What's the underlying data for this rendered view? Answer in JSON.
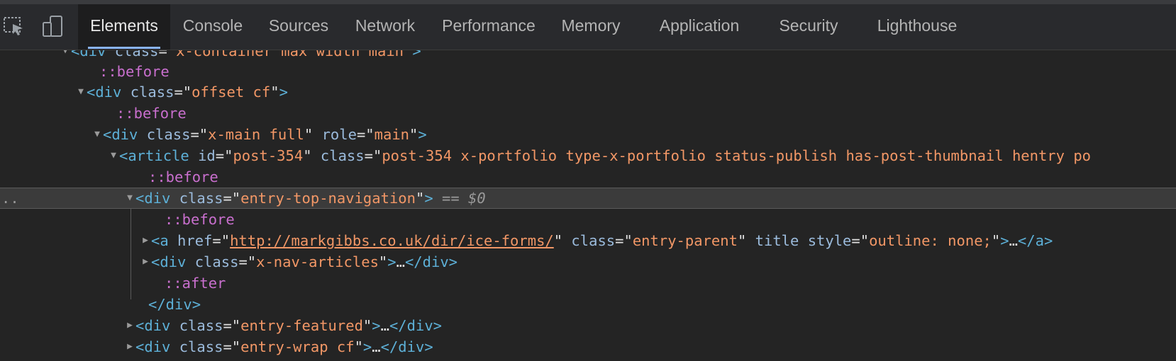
{
  "toolbar": {
    "icons": [
      "inspect-element-icon",
      "device-toolbar-icon"
    ],
    "tabs": [
      {
        "label": "Elements",
        "active": true
      },
      {
        "label": "Console"
      },
      {
        "label": "Sources"
      },
      {
        "label": "Network"
      },
      {
        "label": "Performance"
      },
      {
        "label": "Memory"
      },
      {
        "label": "Application"
      },
      {
        "label": "Security"
      },
      {
        "label": "Lighthouse"
      }
    ]
  },
  "colors": {
    "background": "#242424",
    "tag": "#5db0d7",
    "attribute_name": "#9bbbdc",
    "attribute_value": "#f29766",
    "pseudo_element": "#c96fce",
    "active_tab_underline": "#8ab4f8"
  },
  "dom_tree": {
    "rows": [
      {
        "parts": [
          {
            "t": "<div",
            "c": "tag"
          },
          {
            "t": " class",
            "c": "attr"
          },
          {
            "t": "=\"",
            "c": "text"
          },
          {
            "t": "x-container max width main",
            "c": "val"
          },
          {
            "t": "\">",
            "c": "tag"
          }
        ]
      },
      {
        "parts": [
          {
            "t": "::before",
            "c": "pseudo"
          }
        ]
      },
      {
        "parts": [
          {
            "t": "<div",
            "c": "tag"
          },
          {
            "t": " class",
            "c": "attr"
          },
          {
            "t": "=\"",
            "c": "text"
          },
          {
            "t": "offset cf",
            "c": "val"
          },
          {
            "t": "\"",
            "c": "text"
          },
          {
            "t": ">",
            "c": "tag"
          }
        ]
      },
      {
        "parts": [
          {
            "t": "::before",
            "c": "pseudo"
          }
        ]
      },
      {
        "parts": [
          {
            "t": "<div",
            "c": "tag"
          },
          {
            "t": " class",
            "c": "attr"
          },
          {
            "t": "=\"",
            "c": "text"
          },
          {
            "t": "x-main full",
            "c": "val"
          },
          {
            "t": "\"",
            "c": "text"
          },
          {
            "t": " role",
            "c": "attr"
          },
          {
            "t": "=\"",
            "c": "text"
          },
          {
            "t": "main",
            "c": "val"
          },
          {
            "t": "\"",
            "c": "text"
          },
          {
            "t": ">",
            "c": "tag"
          }
        ]
      },
      {
        "parts": [
          {
            "t": "<article",
            "c": "tag"
          },
          {
            "t": " id",
            "c": "attr"
          },
          {
            "t": "=\"",
            "c": "text"
          },
          {
            "t": "post-354",
            "c": "val"
          },
          {
            "t": "\"",
            "c": "text"
          },
          {
            "t": " class",
            "c": "attr"
          },
          {
            "t": "=\"",
            "c": "text"
          },
          {
            "t": "post-354 x-portfolio type-x-portfolio status-publish has-post-thumbnail hentry po",
            "c": "val"
          }
        ]
      },
      {
        "parts": [
          {
            "t": "::before",
            "c": "pseudo"
          }
        ]
      },
      {
        "parts": [
          {
            "t": "<div",
            "c": "tag"
          },
          {
            "t": " class",
            "c": "attr"
          },
          {
            "t": "=\"",
            "c": "text"
          },
          {
            "t": "entry-top-navigation",
            "c": "val"
          },
          {
            "t": "\"",
            "c": "text"
          },
          {
            "t": ">",
            "c": "tag"
          },
          {
            "t": " == ",
            "c": "dim"
          },
          {
            "t": "$0",
            "c": "ref"
          }
        ]
      },
      {
        "parts": [
          {
            "t": "::before",
            "c": "pseudo"
          }
        ]
      },
      {
        "parts": [
          {
            "t": "<a",
            "c": "tag"
          },
          {
            "t": " href",
            "c": "attr"
          },
          {
            "t": "=\"",
            "c": "text"
          },
          {
            "t": "http://markgibbs.co.uk/dir/ice-forms/",
            "c": "link"
          },
          {
            "t": "\"",
            "c": "text"
          },
          {
            "t": " class",
            "c": "attr"
          },
          {
            "t": "=\"",
            "c": "text"
          },
          {
            "t": "entry-parent",
            "c": "val"
          },
          {
            "t": "\"",
            "c": "text"
          },
          {
            "t": " title style",
            "c": "attr"
          },
          {
            "t": "=\"",
            "c": "text"
          },
          {
            "t": "outline: none;",
            "c": "val"
          },
          {
            "t": "\"",
            "c": "text"
          },
          {
            "t": ">",
            "c": "tag"
          },
          {
            "t": "…",
            "c": "text"
          },
          {
            "t": "</a>",
            "c": "tag"
          }
        ]
      },
      {
        "parts": [
          {
            "t": "<div",
            "c": "tag"
          },
          {
            "t": " class",
            "c": "attr"
          },
          {
            "t": "=\"",
            "c": "text"
          },
          {
            "t": "x-nav-articles",
            "c": "val"
          },
          {
            "t": "\"",
            "c": "text"
          },
          {
            "t": ">",
            "c": "tag"
          },
          {
            "t": "…",
            "c": "text"
          },
          {
            "t": "</div>",
            "c": "tag"
          }
        ]
      },
      {
        "parts": [
          {
            "t": "::after",
            "c": "pseudo"
          }
        ]
      },
      {
        "parts": [
          {
            "t": "</div>",
            "c": "tag"
          }
        ]
      },
      {
        "parts": [
          {
            "t": "<div",
            "c": "tag"
          },
          {
            "t": " class",
            "c": "attr"
          },
          {
            "t": "=\"",
            "c": "text"
          },
          {
            "t": "entry-featured",
            "c": "val"
          },
          {
            "t": "\"",
            "c": "text"
          },
          {
            "t": ">",
            "c": "tag"
          },
          {
            "t": "…",
            "c": "text"
          },
          {
            "t": "</div>",
            "c": "tag"
          }
        ]
      },
      {
        "parts": [
          {
            "t": "<div",
            "c": "tag"
          },
          {
            "t": " class",
            "c": "attr"
          },
          {
            "t": "=\"",
            "c": "text"
          },
          {
            "t": "entry-wrap cf",
            "c": "val"
          },
          {
            "t": "\"",
            "c": "text"
          },
          {
            "t": ">",
            "c": "tag"
          },
          {
            "t": "…",
            "c": "text"
          },
          {
            "t": "</div>",
            "c": "tag"
          }
        ]
      }
    ]
  },
  "selection_marker": ".."
}
